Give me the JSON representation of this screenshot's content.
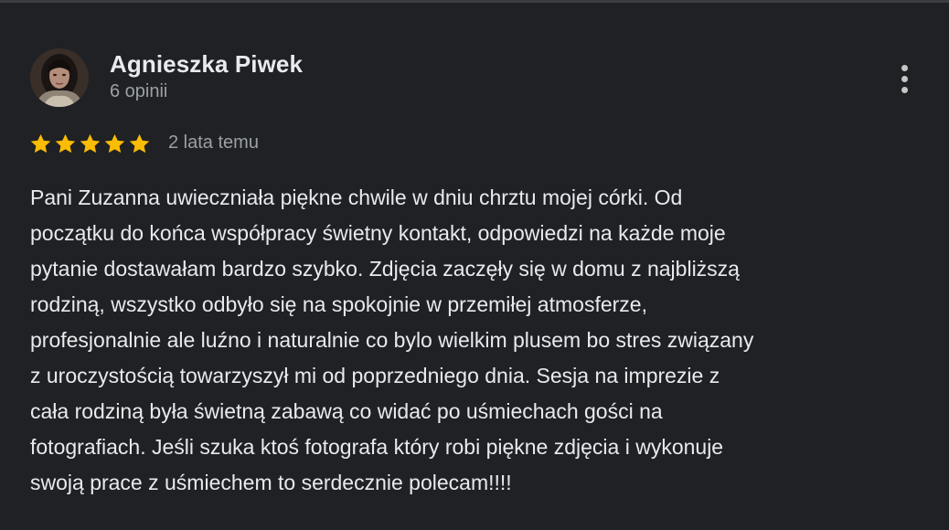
{
  "review": {
    "author_name": "Agnieszka Piwek",
    "author_reviews": "6 opinii",
    "rating": 5,
    "rating_max": 5,
    "time_ago": "2 lata temu",
    "text": "Pani Zuzanna uwieczniała piękne chwile w dniu chrztu mojej córki. Od\npoczątku do końca współpracy świetny kontakt, odpowiedzi na każde moje\npytanie dostawałam bardzo szybko. Zdjęcia zaczęły się w domu z najbliższą\nrodziną, wszystko odbyło się na spokojnie w przemiłej atmosferze,\nprofesjonalnie ale luźno i naturalnie co bylo wielkim plusem bo stres związany\nz uroczystością towarzyszył mi od poprzedniego dnia. Sesja na imprezie z\ncała rodziną była świetną zabawą co widać po uśmiechach gości na\nfotografiach. Jeśli szuka ktoś fotografa który robi piękne zdjęcia i wykonuje\nswoją prace z uśmiechem to serdecznie polecam!!!!"
  },
  "icons": {
    "avatar": "user-avatar-photo",
    "more": "more-vertical-icon",
    "star": "star-filled-icon"
  },
  "colors": {
    "background": "#202124",
    "star": "#fbbc04",
    "text_primary": "#e8eaed",
    "text_secondary": "#9aa0a6"
  }
}
